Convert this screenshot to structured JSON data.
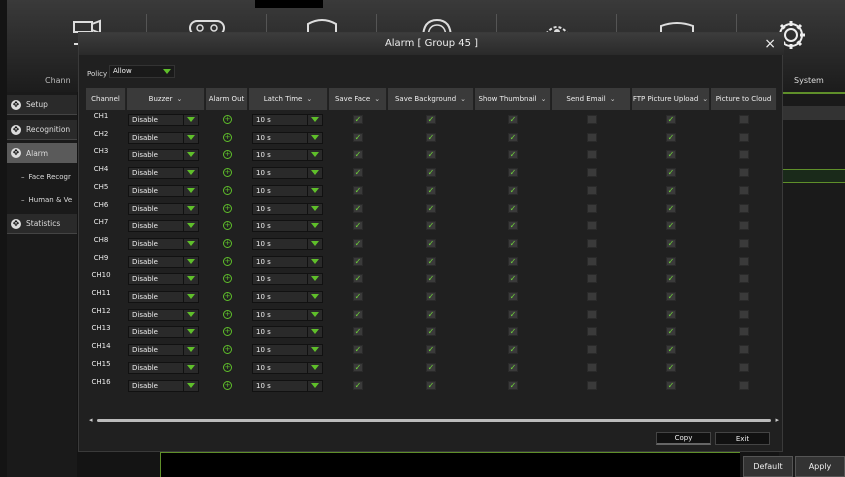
{
  "top_nav": {
    "channel_label": "Chann",
    "system_label": "System"
  },
  "sidebar": {
    "items": [
      {
        "label": "Setup",
        "type": "main"
      },
      {
        "label": "Recognition",
        "type": "main"
      },
      {
        "label": "Alarm",
        "type": "active"
      },
      {
        "label": "Face Recogr",
        "type": "sub"
      },
      {
        "label": "Human & Ve",
        "type": "sub"
      },
      {
        "label": "Statistics",
        "type": "main"
      }
    ]
  },
  "dialog": {
    "title": "Alarm [ Group 45 ]",
    "close": "×",
    "policy_label": "Policy",
    "policy_value": "Allow",
    "columns": [
      "Channel",
      "Buzzer",
      "Alarm Out",
      "Latch Time",
      "Save Face",
      "Save Background",
      "Show Thumbnail",
      "Send Email",
      "FTP Picture Upload",
      "Picture to Cloud"
    ],
    "rows": [
      {
        "channel": "CH1",
        "buzzer": "Disable",
        "latch": "10 s"
      },
      {
        "channel": "CH2",
        "buzzer": "Disable",
        "latch": "10 s"
      },
      {
        "channel": "CH3",
        "buzzer": "Disable",
        "latch": "10 s"
      },
      {
        "channel": "CH4",
        "buzzer": "Disable",
        "latch": "10 s"
      },
      {
        "channel": "CH5",
        "buzzer": "Disable",
        "latch": "10 s"
      },
      {
        "channel": "CH6",
        "buzzer": "Disable",
        "latch": "10 s"
      },
      {
        "channel": "CH7",
        "buzzer": "Disable",
        "latch": "10 s"
      },
      {
        "channel": "CH8",
        "buzzer": "Disable",
        "latch": "10 s"
      },
      {
        "channel": "CH9",
        "buzzer": "Disable",
        "latch": "10 s"
      },
      {
        "channel": "CH10",
        "buzzer": "Disable",
        "latch": "10 s"
      },
      {
        "channel": "CH11",
        "buzzer": "Disable",
        "latch": "10 s"
      },
      {
        "channel": "CH12",
        "buzzer": "Disable",
        "latch": "10 s"
      },
      {
        "channel": "CH13",
        "buzzer": "Disable",
        "latch": "10 s"
      },
      {
        "channel": "CH14",
        "buzzer": "Disable",
        "latch": "10 s"
      },
      {
        "channel": "CH15",
        "buzzer": "Disable",
        "latch": "10 s"
      },
      {
        "channel": "CH16",
        "buzzer": "Disable",
        "latch": "10 s"
      }
    ],
    "copy_label": "Copy",
    "exit_label": "Exit"
  },
  "footer": {
    "default_label": "Default",
    "apply_label": "Apply"
  },
  "colors": {
    "accent_green": "#5fbf2a",
    "check_green": "#6fd63a"
  },
  "icons": [
    "camera-icon",
    "record-icon",
    "search-icon",
    "network-icon",
    "storage-icon",
    "gear-icon",
    "add-circle-icon",
    "checkmark-icon"
  ]
}
